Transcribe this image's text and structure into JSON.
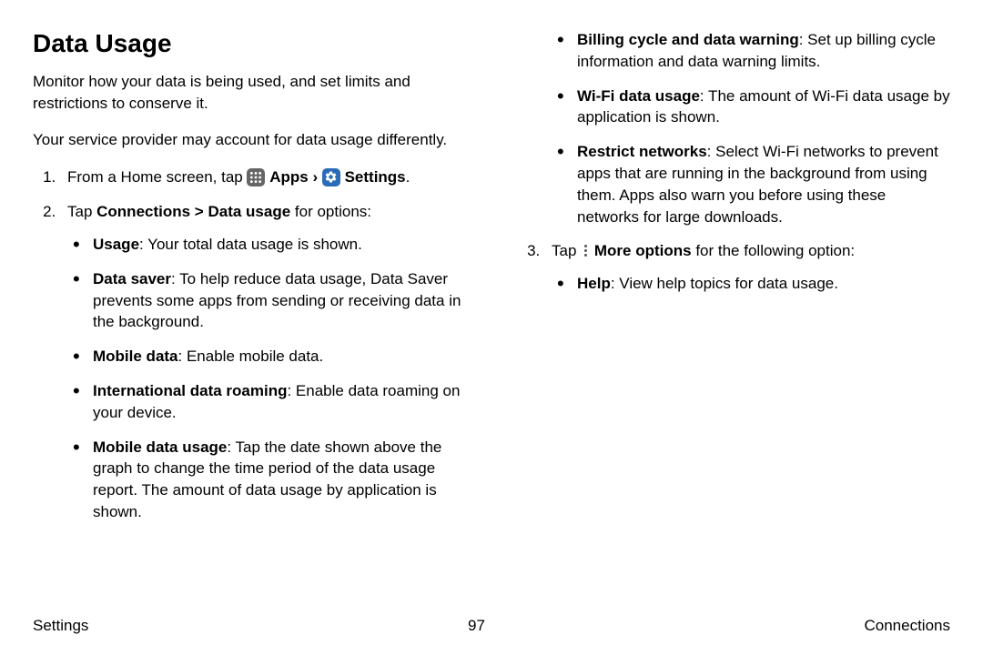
{
  "title": "Data Usage",
  "intro1": "Monitor how your data is being used, and set limits and restrictions to conserve it.",
  "intro2": "Your service provider may account for data usage differently.",
  "step1": {
    "prefix": "From a Home screen, tap ",
    "apps_label": " Apps ",
    "chevron": "›",
    "settings_label": " Settings",
    "suffix": "."
  },
  "step2": {
    "prefix": "Tap ",
    "bold": "Connections > Data usage",
    "suffix": " for options:"
  },
  "bullets2": [
    {
      "label": "Usage",
      "desc": ": Your total data usage is shown."
    },
    {
      "label": "Data saver",
      "desc": ": To help reduce data usage, Data Saver prevents some apps from sending or receiving data in the background."
    },
    {
      "label": "Mobile data",
      "desc": ": Enable mobile data."
    },
    {
      "label": "International data roaming",
      "desc": ": Enable data roaming on your device."
    },
    {
      "label": "Mobile data usage",
      "desc": ": Tap the date shown above the graph to change the time period of the data usage report. The amount of data usage by application is shown."
    },
    {
      "label": "Billing cycle and data warning",
      "desc": ": Set up billing cycle information and data warning limits."
    },
    {
      "label": "Wi-Fi data usage",
      "desc": ": The amount of Wi-Fi data usage by application is shown."
    },
    {
      "label": "Restrict networks",
      "desc": ": Select Wi-Fi networks to prevent apps that are running in the background from using them. Apps also warn you before using these networks for large downloads."
    }
  ],
  "step3": {
    "prefix": "Tap ",
    "more_label": " More options",
    "suffix": " for the following option:"
  },
  "bullets3": [
    {
      "label": "Help",
      "desc": ": View help topics for data usage."
    }
  ],
  "footer": {
    "left": "Settings",
    "center": "97",
    "right": "Connections"
  }
}
